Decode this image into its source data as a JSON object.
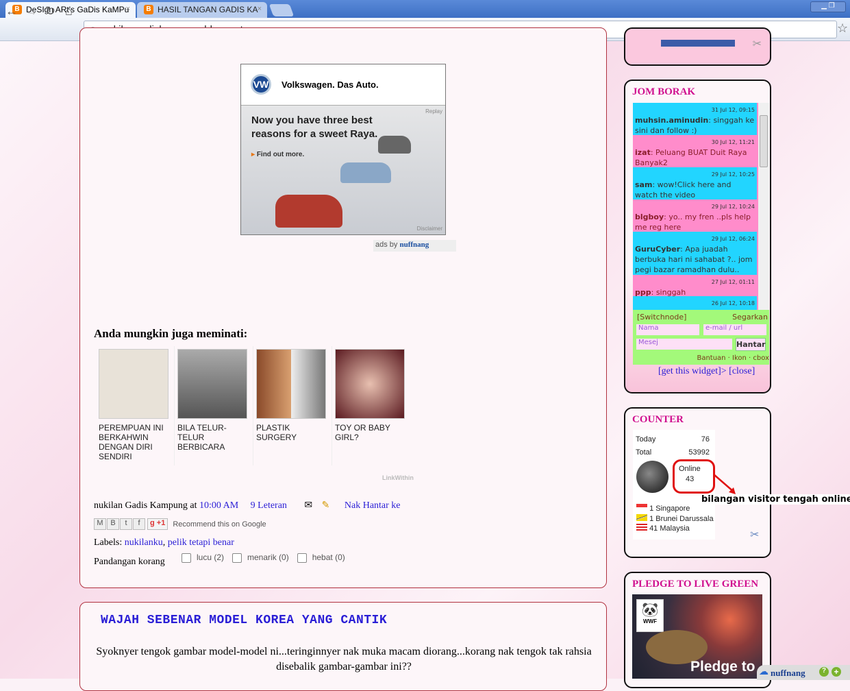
{
  "browser": {
    "tabs": [
      {
        "title": "DeSIgn ARt's GaDis KaMPu"
      },
      {
        "title": "HASIL TANGAN GADIS KA"
      }
    ],
    "url": "nukilangadiskampung.blogspot.com"
  },
  "ad": {
    "brand": "Volkswagen. Das Auto.",
    "headline": "Now you have three best reasons for a sweet Raya.",
    "cta": "Find out more.",
    "replay": "Replay",
    "disclaimer": "Disclaimer",
    "adsby": "ads by",
    "network": "nuffnang"
  },
  "related": {
    "title": "Anda mungkin juga meminati:",
    "items": [
      {
        "label": "PEREMPUAN INI BERKAHWIN DENGAN DIRI SENDIRI"
      },
      {
        "label": "BILA TELUR-TELUR BERBICARA"
      },
      {
        "label": "PLASTIK SURGERY"
      },
      {
        "label": "TOY OR BABY GIRL?"
      }
    ],
    "credit": "LinkWithin"
  },
  "footer": {
    "author": "nukilan Gadis Kampung at",
    "time": "10:00 AM",
    "comments": "9 Leteran",
    "send": "Nak Hantar ke",
    "plusone": "+1",
    "recommend": "Recommend this on Google",
    "labels_prefix": "Labels:",
    "labels": [
      "nukilanku",
      "pelik tetapi benar"
    ],
    "reactions_label": "Pandangan korang",
    "reactions": [
      {
        "label": "lucu (2)"
      },
      {
        "label": "menarik (0)"
      },
      {
        "label": "hebat (0)"
      }
    ]
  },
  "next_post": {
    "title": "WAJAH SEBENAR MODEL KOREA YANG CANTIK",
    "body": "Syoknyer tengok gambar model-model ni...teringinnyer nak muka macam diorang...korang nak tengok tak rahsia disebalik gambar-gambar ini??"
  },
  "jom_borak": {
    "title": "JOM BORAK",
    "messages": [
      {
        "date": "31 Jul 12, 09:15",
        "user": "muhsin.aminudin",
        "text": ": singgah ke sini dan follow :)"
      },
      {
        "date": "30 Jul 12, 11:21",
        "user": "izat",
        "text": ": Peluang BUAT Duit Raya Banyak2"
      },
      {
        "date": "29 Jul 12, 10:25",
        "user": "sam",
        "text": ": wow!Click here and watch the video"
      },
      {
        "date": "29 Jul 12, 10:24",
        "user": "blgboy",
        "text": ": yo.. my fren ..pls help me reg here"
      },
      {
        "date": "29 Jul 12, 06:24",
        "user": "GuruCyber",
        "text": ": Apa juadah berbuka hari ni sahabat ?.. jom pegi bazar ramadhan dulu.."
      },
      {
        "date": "27 Jul 12, 01:11",
        "user": "ppp",
        "text": ": singgah"
      },
      {
        "date": "26 Jul 12, 10:18",
        "user": "",
        "text": ""
      }
    ],
    "switch": "[Switchnode]",
    "refresh": "Segarkan",
    "name_ph": "Nama",
    "email_ph": "e-mail / url",
    "msg_ph": "Mesej",
    "send": "Hantar",
    "links": "Bantuan · Ikon · cbox",
    "get": "[get this widget]> [close]"
  },
  "counter": {
    "title": "COUNTER",
    "today_label": "Today",
    "today": "76",
    "total_label": "Total",
    "total": "53992",
    "online_label": "Online",
    "online": "43",
    "annotation": "bilangan visitor tengah online",
    "countries": [
      {
        "text": "1 Singapore"
      },
      {
        "text": "1 Brunei Darussala"
      },
      {
        "text": "41 Malaysia"
      }
    ]
  },
  "pledge": {
    "title": "PLEDGE TO LIVE GREEN",
    "overlay": "Pledge to",
    "wwf": "WWF"
  },
  "nuffnang_bar": {
    "label": "nuffnang"
  }
}
